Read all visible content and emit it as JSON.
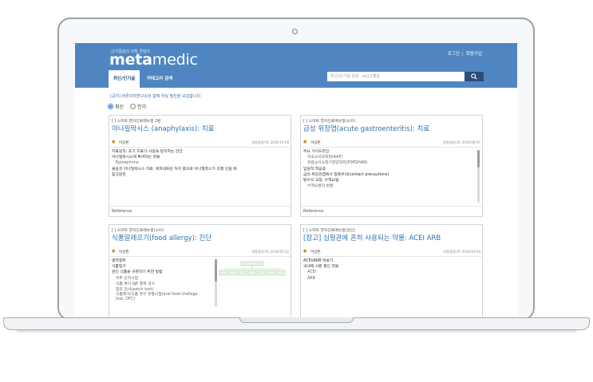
{
  "site": {
    "tagline": "근거중심의 의학 콘텐츠",
    "logo_bold": "meta",
    "logo_rest": "medic",
    "login": "로그인",
    "signup": "회원가입"
  },
  "tabs": [
    "최신/인기글",
    "카테고리 검색"
  ],
  "search": {
    "placeholder": "최신/인기글 검색 : ex)고혈압"
  },
  "notice": "[공지] 바른의학연구소와 함께 하실 필진을 모집합니다.",
  "filters": {
    "latest": "최신",
    "popular": "인기"
  },
  "cards": [
    {
      "category": "[ ] 스마트 영자진료매뉴얼 2판",
      "title": "아나필락시스 (anaphylaxis): 치료",
      "author": "이상돈",
      "date": "최종업데이트 2018-10-08",
      "lines": [
        {
          "t": "치료원칙: 초기 치료가 사망을 방지하는 관건",
          "ind": false
        },
        {
          "t": "아나필락시스에 투여하는 약물",
          "ind": false
        },
        {
          "t": "Epinephrine",
          "ind": true
        },
        {
          "t": "불응성 아나필락시스 치료: 에피네프린 처치 중으로 아나필락스가 조절 안될 때",
          "ind": false
        },
        {
          "t": "참고문헌",
          "ind": false
        }
      ],
      "reference": "Reference"
    },
    {
      "category": "[ ] 스마트 영자진료매뉴얼(소아)",
      "title": "급성 위장염(acute gastroenteritis): 치료",
      "author": "이상돈",
      "date": "최종업데이트 2018-08-07",
      "lines": [
        {
          "t": "주요 가이드라인",
          "ind": false
        },
        {
          "t": "미국소아과학회(AAP)",
          "ind": true
        },
        {
          "t": "유럽소아소화기영양학회(ESPGHAN)",
          "ind": true
        },
        {
          "t": "입원적 적응증",
          "ind": false
        },
        {
          "t": "급성 위장관염에서 접촉주의(contact precautions)",
          "ind": false
        },
        {
          "t": "탈수의 교정: 수액요법",
          "ind": false
        },
        {
          "t": "수액요법의 방법",
          "ind": true
        }
      ],
      "reference": "Reference"
    },
    {
      "category": "[ ] 스마트 영자진료매뉴얼(소아)",
      "title": "식품알레르기(food allergy): 진단",
      "author": "이상돈",
      "date": "최종업데이트 2018-05-22",
      "lines": [
        {
          "t": "병력청취",
          "ind": false
        },
        {
          "t": "식품일기",
          "ind": false
        },
        {
          "t": "원인 식품을 규명하기 위한 방법",
          "ind": false
        },
        {
          "t": "피부 단자시험",
          "ind": true
        },
        {
          "t": "식품 특이 IgE 항체 검사",
          "ind": true
        },
        {
          "t": "첩포 검사(patch test)",
          "ind": true
        },
        {
          "t": "식품제거/식품 경구 유발시험(oral food challege",
          "ind": true
        },
        {
          "t": "test, OFC)",
          "ind": true
        }
      ]
    },
    {
      "category": "[ ] 스마트 영자진료매뉴얼(성인)",
      "title": "[참고] 심혈관에 흔히 사용되는 약물: ACEI ARB",
      "author": "이상돈",
      "date": "최종업데이트 2018-01-04",
      "lines": [
        {
          "t": "ACEI/ARB 멋보기",
          "ind": false
        },
        {
          "t": "국내에 시판 중인 약물",
          "ind": false
        },
        {
          "t": "ACEI",
          "ind": true
        },
        {
          "t": "ARB",
          "ind": true
        }
      ]
    }
  ]
}
